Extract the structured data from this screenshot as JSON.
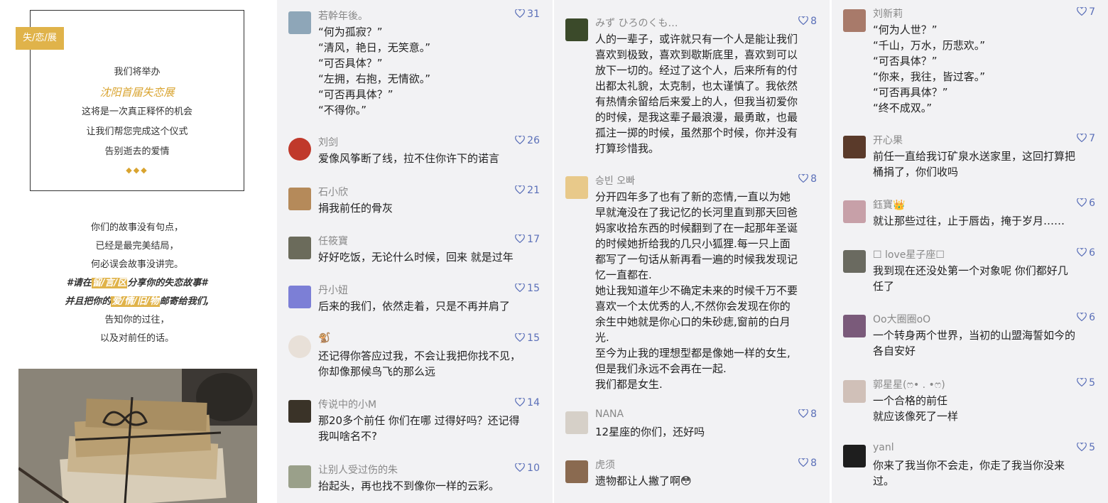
{
  "poster": {
    "tag": "失/恋/展",
    "lines": [
      "我们将举办",
      "沈阳首届失恋展",
      "这将是一次真正释怀的机会",
      "让我们帮您完成这个仪式",
      "告别逝去的爱情"
    ],
    "diamonds": "◆◆◆",
    "story": {
      "l1": "你们的故事没有句点，",
      "l2": "已经是最完美结局，",
      "l3": "何必误会故事没讲完。",
      "l4a": "#请在",
      "l4b": "留/言/区",
      "l4c": "分享你的失恋故事#",
      "l5a": "并且把你的",
      "l5b": "爱/情/旧/物",
      "l5c": "邮寄给我们,",
      "l6": "告知你的过往，",
      "l7": "以及对前任的话。"
    }
  },
  "columns": [
    [
      {
        "name": "若幹年後。",
        "likes": "31",
        "text": "“何为孤寂？”\n“清风，艳日，无笑意。”\n“可否具体？”\n“左拥，右抱，无情欲。”\n“可否再具体？”\n“不得你。”",
        "avatar_color": "#8ea6b8"
      },
      {
        "name": "刘剑",
        "likes": "26",
        "text": "爱像风筝断了线，拉不住你许下的诺言",
        "avatar_color": "#c0392b"
      },
      {
        "name": "石小欣",
        "likes": "21",
        "text": "捐我前任的骨灰",
        "avatar_color": "#b58a5a"
      },
      {
        "name": "任筱寶",
        "likes": "17",
        "text": "好好吃饭，无论什么时候，回来 就是过年",
        "avatar_color": "#6b6b5b"
      },
      {
        "name": "丹小妞",
        "likes": "15",
        "text": "后来的我们，依然走着，只是不再并肩了",
        "avatar_color": "#7c7fd6"
      },
      {
        "name": "🐒",
        "likes": "15",
        "text": "还记得你答应过我，不会让我把你找不见，\n你却像那候鸟飞的那么远",
        "avatar_color": "#e8e0d8"
      },
      {
        "name": "传说中的小M",
        "likes": "14",
        "text": "那20多个前任 你们在哪 过得好吗？还记得\n我叫啥名不?",
        "avatar_color": "#3a3328"
      },
      {
        "name": "让别人受过伤的朱",
        "likes": "10",
        "text": "抬起头，再也找不到像你一样的云彩。",
        "avatar_color": "#9aa08a"
      }
    ],
    [
      {
        "name": "みず ひろのくも…",
        "likes": "8",
        "text": "人的一辈子，或许就只有一个人是能让我们\n喜欢到极致，喜欢到歇斯底里，喜欢到可以\n放下一切的。经过了这个人，后来所有的付\n出都太礼貌，太克制，也太谨慎了。我依然\n有热情余留给后来爱上的人，但我当初爱你\n的时候，是我这辈子最浪漫，最勇敢，也最\n孤注一掷的时候，虽然那个时候，你并没有\n打算珍惜我。",
        "avatar_color": "#3b4a2a"
      },
      {
        "name": "승빈 오빠",
        "likes": "8",
        "text": "分开四年多了也有了新的恋情,一直以为她\n早就淹没在了我记忆的长河里直到那天回爸\n妈家收拾东西的时候翻到了在一起那年圣诞\n的时候她折给我的几只小狐狸.每一只上面\n都写了一句话从新再看一遍的时候我发现记\n忆一直都在.\n她让我知道年少不确定未来的时候千万不要\n喜欢一个太优秀的人,不然你会发现在你的\n余生中她就是你心口的朱砂痣,窗前的白月\n光.\n至今为止我的理想型都是像她一样的女生,\n但是我们永远不会再在一起.\n我们都是女生.",
        "avatar_color": "#e8c98a"
      },
      {
        "name": "NANA",
        "likes": "8",
        "text": "12星座的你们，还好吗",
        "avatar_color": "#d6d0c8"
      },
      {
        "name": "虎须",
        "likes": "8",
        "text": "遗物都让人撇了啊😳",
        "avatar_color": "#8a6a50"
      }
    ],
    [
      {
        "name": "刘新莉",
        "likes": "7",
        "text": "“何为人世？”\n“千山，万水，历悲欢。”\n“可否具体？”\n“你来，我往，皆过客。”\n“可否再具体？”\n“终不成双。”",
        "avatar_color": "#a87a6a"
      },
      {
        "name": "开心果",
        "likes": "7",
        "text": "前任一直给我订矿泉水送家里，这回打算把\n桶捐了，你们收吗",
        "avatar_color": "#5a3a2a"
      },
      {
        "name": "鈺寶👑",
        "likes": "6",
        "text": "就让那些过往，止于唇齿，掩于岁月……",
        "avatar_color": "#c7a0a8"
      },
      {
        "name": "☐ love星子座☐",
        "likes": "6",
        "text": "我到现在还没处第一个对象呢  你们都好几\n任了",
        "avatar_color": "#6a6a60"
      },
      {
        "name": "Oo大圈圈oO",
        "likes": "6",
        "text": "一个转身两个世界，当初的山盟海誓如今的\n各自安好",
        "avatar_color": "#7a5a7a"
      },
      {
        "name": "郭星星(ෆ• . •ෆ)",
        "likes": "5",
        "text": "一个合格的前任\n就应该像死了一样",
        "avatar_color": "#d0c0b8"
      },
      {
        "name": "yanl",
        "likes": "5",
        "text": "你来了我当你不会走，你走了我当你没来\n过。",
        "avatar_color": "#1e1e1e"
      }
    ]
  ],
  "colors": {
    "accent": "#e0b34a",
    "like": "#5a6fb8",
    "panel": "#f2f2f4"
  }
}
